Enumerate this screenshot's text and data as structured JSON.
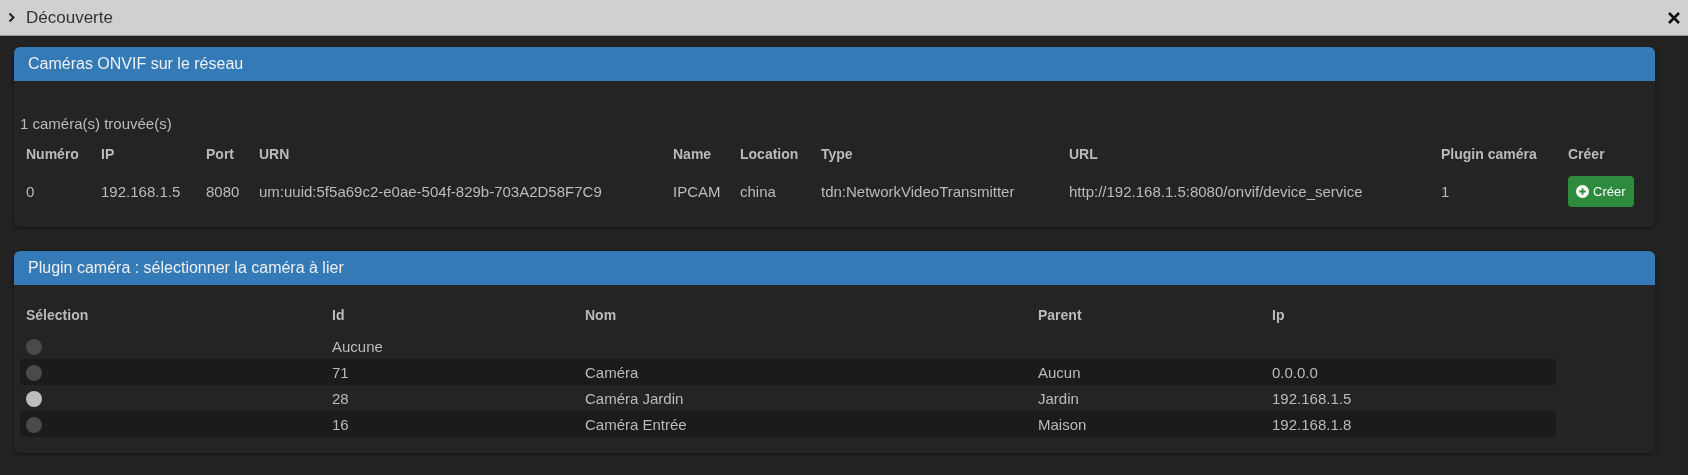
{
  "window": {
    "title": "Découverte",
    "expanded": true
  },
  "onvif_panel": {
    "title": "Caméras ONVIF sur le réseau",
    "count": "1 caméra(s) trouvée(s)",
    "columns": [
      "Numéro",
      "IP",
      "Port",
      "URN",
      "Name",
      "Location",
      "Type",
      "URL",
      "Plugin caméra",
      "Créer"
    ],
    "rows": [
      {
        "cells": [
          "0",
          "192.168.1.5",
          "8080",
          "um:uuid:5f5a69c2-e0ae-504f-829b-703A2D58F7C9",
          "IPCAM",
          "china",
          "tdn:NetworkVideoTransmitter",
          "http://192.168.1.5:8080/onvif/device_service",
          "1"
        ],
        "button": "Créer"
      }
    ]
  },
  "plugin_panel": {
    "title": "Plugin caméra : sélectionner la caméra à lier",
    "columns": [
      "Sélection",
      "Id",
      "Nom",
      "Parent",
      "Ip"
    ],
    "rows": [
      {
        "selected": false,
        "cells": [
          "",
          "Aucune",
          "",
          "",
          ""
        ]
      },
      {
        "selected": false,
        "cells": [
          "",
          "71",
          "Caméra",
          "Aucun",
          "0.0.0.0"
        ]
      },
      {
        "selected": true,
        "cells": [
          "",
          "28",
          "Caméra Jardin",
          "Jardin",
          "192.168.1.5"
        ]
      },
      {
        "selected": false,
        "cells": [
          "",
          "16",
          "Caméra Entrée",
          "Maison",
          "192.168.1.8"
        ]
      }
    ]
  }
}
